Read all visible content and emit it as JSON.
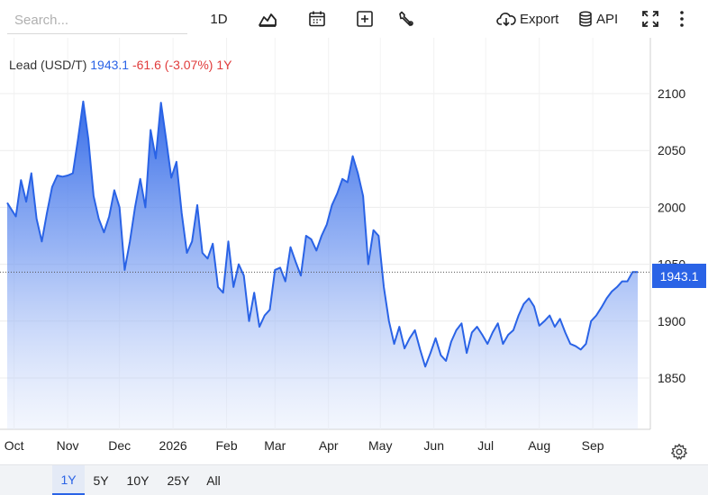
{
  "toolbar": {
    "search_placeholder": "Search...",
    "interval_label": "1D",
    "export_label": "Export",
    "api_label": "API"
  },
  "legend": {
    "name": "Lead (USD/T)",
    "price": "1943.1",
    "change": "-61.6 (-3.07%)",
    "range": "1Y"
  },
  "price_tag": "1943.1",
  "ranges": {
    "items": [
      "1Y",
      "5Y",
      "10Y",
      "25Y",
      "All"
    ],
    "active": "1Y"
  },
  "colors": {
    "line": "#2a63e6",
    "positive": "#2a63e6",
    "negative": "#e03b3b"
  },
  "chart_data": {
    "type": "area",
    "title": "Lead (USD/T)",
    "series": [
      {
        "name": "Lead (USD/T)",
        "x": [
          "2024-09-27",
          "2024-10-02",
          "2024-10-05",
          "2024-10-08",
          "2024-10-11",
          "2024-10-14",
          "2024-10-17",
          "2024-10-20",
          "2024-10-23",
          "2024-10-26",
          "2024-10-29",
          "2024-11-01",
          "2024-11-04",
          "2024-11-07",
          "2024-11-10",
          "2024-11-13",
          "2024-11-16",
          "2024-11-19",
          "2024-11-22",
          "2024-11-25",
          "2024-11-28",
          "2024-12-01",
          "2024-12-04",
          "2024-12-07",
          "2024-12-10",
          "2024-12-13",
          "2024-12-16",
          "2024-12-19",
          "2024-12-22",
          "2024-12-25",
          "2024-12-28",
          "2024-12-31",
          "2025-01-03",
          "2025-01-06",
          "2025-01-09",
          "2025-01-12",
          "2025-01-15",
          "2025-01-18",
          "2025-01-21",
          "2025-01-24",
          "2025-01-27",
          "2025-01-30",
          "2025-02-02",
          "2025-02-05",
          "2025-02-08",
          "2025-02-11",
          "2025-02-14",
          "2025-02-17",
          "2025-02-20",
          "2025-02-23",
          "2025-02-26",
          "2025-03-01",
          "2025-03-04",
          "2025-03-07",
          "2025-03-10",
          "2025-03-13",
          "2025-03-16",
          "2025-03-19",
          "2025-03-22",
          "2025-03-25",
          "2025-03-28",
          "2025-03-31",
          "2025-04-03",
          "2025-04-06",
          "2025-04-09",
          "2025-04-12",
          "2025-04-15",
          "2025-04-18",
          "2025-04-21",
          "2025-04-24",
          "2025-04-27",
          "2025-04-30",
          "2025-05-03",
          "2025-05-06",
          "2025-05-09",
          "2025-05-12",
          "2025-05-15",
          "2025-05-18",
          "2025-05-21",
          "2025-05-24",
          "2025-05-27",
          "2025-05-30",
          "2025-06-02",
          "2025-06-05",
          "2025-06-08",
          "2025-06-11",
          "2025-06-14",
          "2025-06-17",
          "2025-06-20",
          "2025-06-23",
          "2025-06-26",
          "2025-06-29",
          "2025-07-02",
          "2025-07-05",
          "2025-07-08",
          "2025-07-11",
          "2025-07-14",
          "2025-07-17",
          "2025-07-20",
          "2025-07-23",
          "2025-07-26",
          "2025-07-29",
          "2025-08-01",
          "2025-08-04",
          "2025-08-07",
          "2025-08-10",
          "2025-08-13",
          "2025-08-16",
          "2025-08-19",
          "2025-08-22",
          "2025-08-25",
          "2025-08-28",
          "2025-08-31",
          "2025-09-03",
          "2025-09-06",
          "2025-09-09",
          "2025-09-12",
          "2025-09-15",
          "2025-09-18",
          "2025-09-21",
          "2025-09-24",
          "2025-09-27"
        ],
        "values": [
          2004,
          1992,
          2024,
          2005,
          2030,
          1990,
          1970,
          1995,
          2018,
          2028,
          2027,
          2028,
          2030,
          2060,
          2093,
          2060,
          2010,
          1990,
          1978,
          1992,
          2015,
          2000,
          1945,
          1970,
          2000,
          2025,
          2000,
          2068,
          2043,
          2092,
          2060,
          2026,
          2040,
          1995,
          1960,
          1970,
          2002,
          1960,
          1955,
          1968,
          1930,
          1925,
          1970,
          1930,
          1950,
          1940,
          1900,
          1925,
          1895,
          1905,
          1910,
          1945,
          1947,
          1935,
          1965,
          1952,
          1940,
          1975,
          1972,
          1962,
          1975,
          1985,
          2002,
          2012,
          2025,
          2022,
          2045,
          2030,
          2010,
          1950,
          1980,
          1975,
          1930,
          1900,
          1880,
          1895,
          1876,
          1885,
          1892,
          1875,
          1860,
          1872,
          1885,
          1870,
          1865,
          1882,
          1892,
          1898,
          1872,
          1890,
          1895,
          1888,
          1880,
          1890,
          1898,
          1880,
          1888,
          1892,
          1905,
          1915,
          1920,
          1913,
          1896,
          1900,
          1905,
          1895,
          1902,
          1890,
          1880,
          1878,
          1875,
          1880,
          1900,
          1905,
          1912,
          1920,
          1926,
          1930,
          1935,
          1935,
          1943.1,
          1943.1
        ]
      }
    ],
    "x_tick_labels": [
      "Oct",
      "Nov",
      "Dec",
      "2026",
      "Feb",
      "Mar",
      "Apr",
      "May",
      "Jun",
      "Jul",
      "Aug",
      "Sep"
    ],
    "y_ticks": [
      1850,
      1900,
      1950,
      2000,
      2050,
      2100
    ],
    "ylim": [
      1800,
      2130
    ],
    "grid": true,
    "last_value": 1943.1,
    "axis_side": "right"
  }
}
